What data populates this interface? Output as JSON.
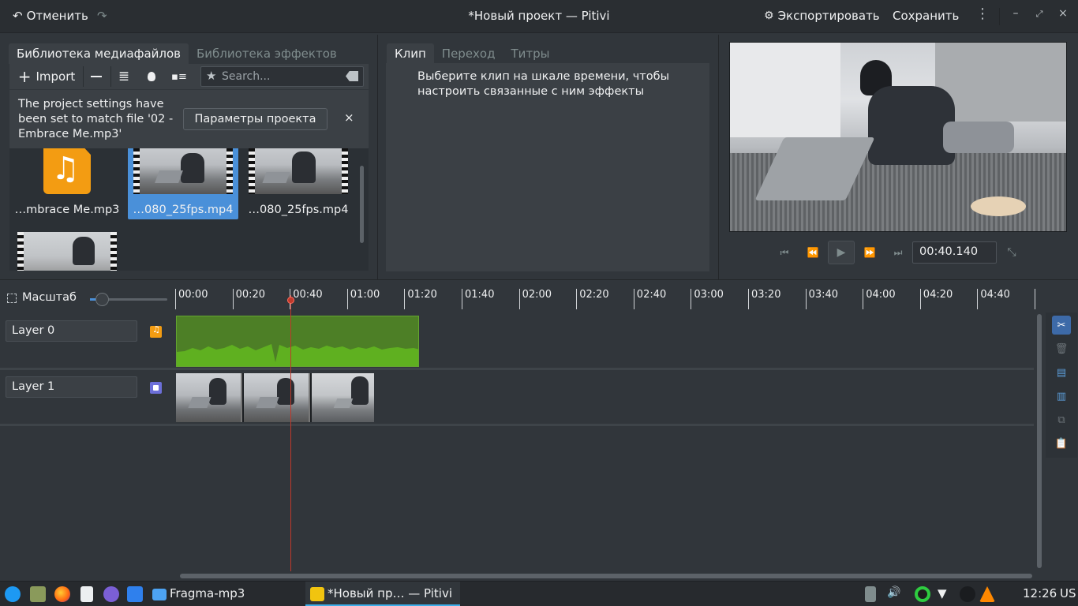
{
  "header": {
    "undo_label": "Отменить",
    "title": "*Новый проект — Pitivi",
    "export_label": "Экспортировать",
    "save_label": "Сохранить"
  },
  "library": {
    "tabs": [
      {
        "label": "Библиотека медиафайлов",
        "active": true
      },
      {
        "label": "Библиотека эффектов",
        "active": false
      }
    ],
    "import_label": "Import",
    "search_placeholder": "Search...",
    "infobar": {
      "message": "The project settings have been set to match file '02 - Embrace Me.mp3'",
      "button_label": "Параметры проекта",
      "close_label": "×"
    },
    "items": [
      {
        "label": "…mbrace Me.mp3",
        "type": "audio",
        "selected": false
      },
      {
        "label": "…080_25fps.mp4",
        "type": "video",
        "selected": true
      },
      {
        "label": "…080_25fps.mp4",
        "type": "video",
        "selected": false
      },
      {
        "label": "",
        "type": "video",
        "selected": false
      }
    ]
  },
  "clip_panel": {
    "tabs": [
      {
        "label": "Клип",
        "active": true
      },
      {
        "label": "Переход",
        "active": false
      },
      {
        "label": "Титры",
        "active": false
      }
    ],
    "hint": "Выберите клип на шкале времени, чтобы настроить связанные с ним эффекты"
  },
  "viewer": {
    "time": "00:40.140"
  },
  "timeline": {
    "zoom_label": "Масштаб",
    "ruler_labels": [
      "00:00",
      "00:20",
      "00:40",
      "01:00",
      "01:20",
      "01:40",
      "02:00",
      "02:20",
      "02:40",
      "03:00",
      "03:20",
      "03:40",
      "04:00",
      "04:20",
      "04:40"
    ],
    "layers": [
      {
        "name": "Layer 0",
        "type": "audio"
      },
      {
        "name": "Layer 1",
        "type": "video"
      }
    ]
  },
  "taskbar": {
    "folder_label": "Fragma-mp3",
    "active_task_label": "*Новый пр… — Pitivi",
    "clock": "12:26",
    "keyboard_layout": "US"
  },
  "colors": {
    "accent": "#4a90d9",
    "audio_clip": "#4d7f26",
    "playhead": "#c0392b"
  }
}
